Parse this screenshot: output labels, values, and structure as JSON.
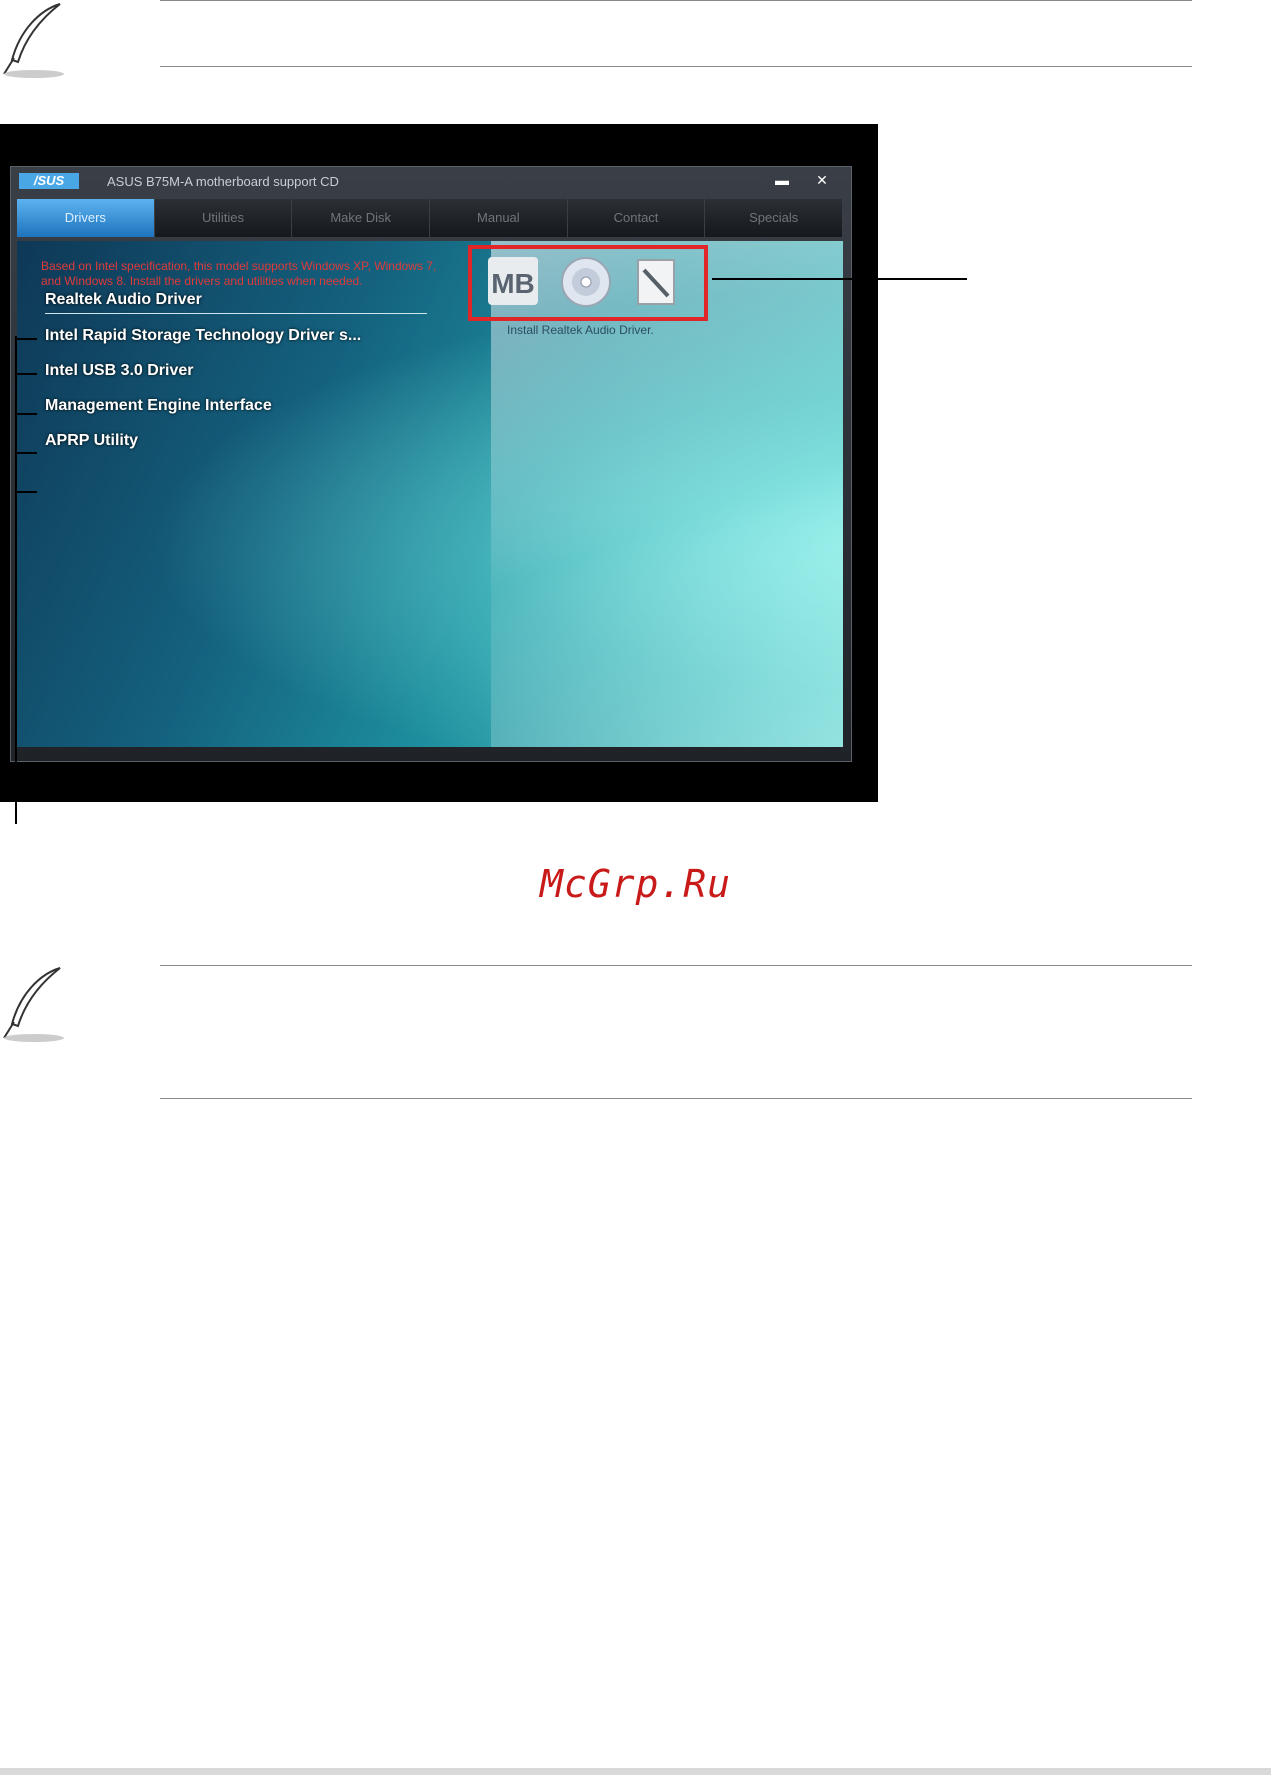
{
  "window": {
    "logo": "/SUS",
    "title": "ASUS B75M-A motherboard support CD",
    "minimize": "▬",
    "close": "✕"
  },
  "tabs": [
    {
      "label": "Drivers",
      "active": true
    },
    {
      "label": "Utilities",
      "active": false
    },
    {
      "label": "Make Disk",
      "active": false
    },
    {
      "label": "Manual",
      "active": false
    },
    {
      "label": "Contact",
      "active": false
    },
    {
      "label": "Specials",
      "active": false
    }
  ],
  "notice": "Based on Intel specification, this model supports Windows XP, Windows 7, and Windows 8. Install the drivers and utilities when needed.",
  "drivers": [
    "Realtek Audio Driver",
    "Intel Rapid Storage Technology Driver s...",
    "Intel USB 3.0 Driver",
    "Management Engine Interface",
    "APRP Utility"
  ],
  "description": "Install Realtek Audio Driver.",
  "icons": {
    "mb_label": "MB",
    "mb": "motherboard-info-icon",
    "cd": "browse-cd-icon",
    "doc": "readme-file-icon"
  },
  "watermark": "McGrp.Ru"
}
